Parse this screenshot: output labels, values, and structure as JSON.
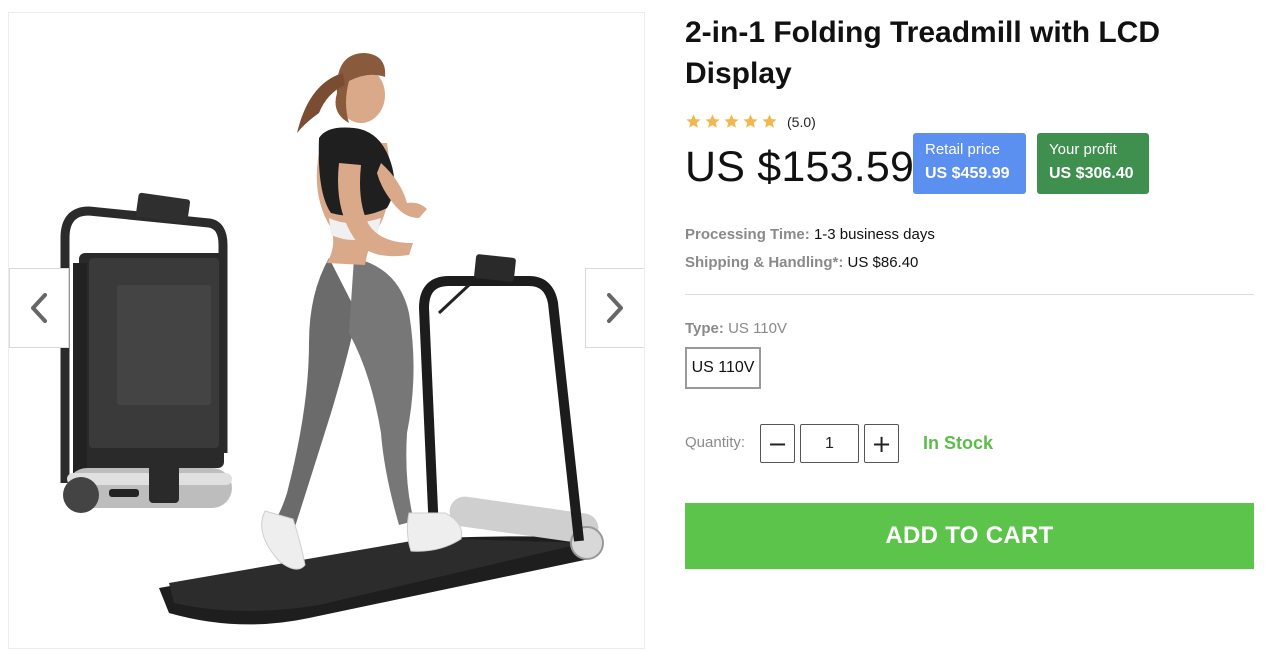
{
  "product": {
    "title": "2-in-1 Folding Treadmill with LCD Display",
    "rating_text": "(5.0)",
    "rating_value": 5,
    "price": "US $153.59"
  },
  "gallery": {
    "image": "folding-treadmill-product-photo",
    "prev_icon": "chevron-left-icon",
    "next_icon": "chevron-right-icon"
  },
  "badges": {
    "retail": {
      "label": "Retail price",
      "value": "US $459.99",
      "color": "#5b8ff0"
    },
    "profit": {
      "label": "Your profit",
      "value": "US $306.40",
      "color": "#3f8f4f"
    }
  },
  "shipping": {
    "processing_label": "Processing Time:",
    "processing_value": "1-3 business days",
    "handling_label": "Shipping & Handling*:",
    "handling_value": "US $86.40"
  },
  "variant": {
    "type_label": "Type:",
    "type_value": "US 110V",
    "options": [
      "US 110V"
    ]
  },
  "quantity": {
    "label": "Quantity:",
    "value": "1",
    "minus": "−",
    "plus": "+",
    "stock": "In Stock"
  },
  "cart": {
    "label": "ADD TO CART",
    "color": "#5cc44b"
  },
  "colors": {
    "star": "#f2b84f",
    "stock": "#5cbc4b"
  }
}
